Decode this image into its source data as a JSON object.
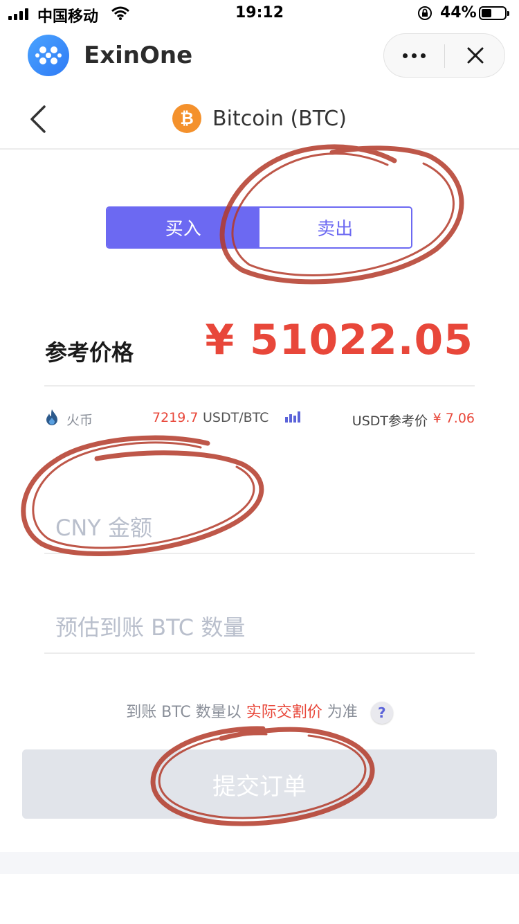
{
  "status_bar": {
    "carrier": "中国移动",
    "time": "19:12",
    "battery_percent": "44%",
    "battery_level": 0.44
  },
  "app_header": {
    "title": "ExinOne"
  },
  "nav": {
    "title": "Bitcoin (BTC)",
    "coin_symbol": "₿"
  },
  "trade_toggle": {
    "buy_label": "买入",
    "sell_label": "卖出",
    "active": "buy"
  },
  "price": {
    "label": "参考价格",
    "value": "¥ 51022.05"
  },
  "exchange": {
    "name": "火币",
    "price": "7219.7",
    "pair": "USDT/BTC",
    "usdt_label": "USDT参考价",
    "usdt_value": "¥ 7.06"
  },
  "form": {
    "cny_placeholder": "CNY 金额",
    "btc_placeholder": "预估到账 BTC 数量"
  },
  "note": {
    "prefix": "到账 BTC 数量以",
    "accent": "实际交割价",
    "suffix": "为准",
    "help": "?"
  },
  "submit_label": "提交订单",
  "colors": {
    "primary": "#6c69f2",
    "price_red": "#e8473a",
    "annotation_red": "#b33a2a",
    "disabled_button": "#e1e4ea"
  }
}
